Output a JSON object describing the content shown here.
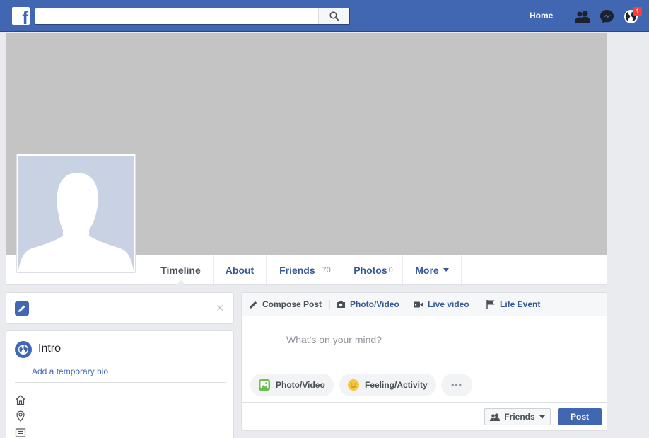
{
  "topbar": {
    "logo_letter": "f",
    "search": {
      "value": "",
      "placeholder": ""
    },
    "home_label": "Home",
    "notification_count": "1",
    "brand_color": "#4267b2"
  },
  "profile": {
    "tabs": [
      {
        "label": "Timeline",
        "count": ""
      },
      {
        "label": "About",
        "count": ""
      },
      {
        "label": "Friends",
        "count": "70"
      },
      {
        "label": "Photos",
        "count": "0"
      },
      {
        "label": "More",
        "count": ""
      }
    ]
  },
  "intro": {
    "title": "Intro",
    "add_bio_label": "Add a temporary bio",
    "close_glyph": "×"
  },
  "composer": {
    "tabs": [
      {
        "label": "Compose Post",
        "icon": "pencil-icon"
      },
      {
        "label": "Photo/Video",
        "icon": "camera-icon"
      },
      {
        "label": "Live video",
        "icon": "video-camera-icon"
      },
      {
        "label": "Life Event",
        "icon": "flag-icon"
      }
    ],
    "placeholder": "What's on your mind?",
    "actions": [
      {
        "label": "Photo/Video",
        "icon": "photo-icon"
      },
      {
        "label": "Feeling/Activity",
        "icon": "smiley-icon"
      },
      {
        "label": "•••",
        "icon": "more-icon"
      }
    ],
    "audience_label": "Friends",
    "post_label": "Post"
  }
}
